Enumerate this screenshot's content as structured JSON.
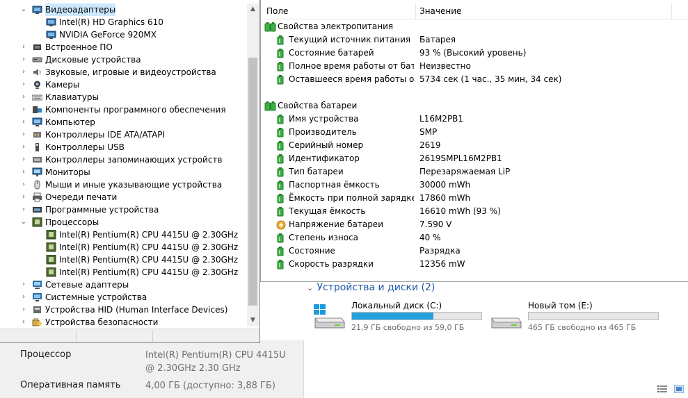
{
  "device_manager": {
    "tree": [
      {
        "label": "Видеоадаптеры",
        "expanded": true,
        "level": 0,
        "icon": "display-adapter-icon",
        "selected": true
      },
      {
        "label": "Intel(R) HD Graphics 610",
        "level": 1,
        "icon": "display-adapter-icon"
      },
      {
        "label": "NVIDIA GeForce 920MX",
        "level": 1,
        "icon": "display-adapter-icon"
      },
      {
        "label": "Встроенное ПО",
        "expanded": false,
        "level": 0,
        "icon": "firmware-icon"
      },
      {
        "label": "Дисковые устройства",
        "expanded": false,
        "level": 0,
        "icon": "disk-drive-icon"
      },
      {
        "label": "Звуковые, игровые и видеоустройства",
        "expanded": false,
        "level": 0,
        "icon": "speaker-icon"
      },
      {
        "label": "Камеры",
        "expanded": false,
        "level": 0,
        "icon": "camera-icon"
      },
      {
        "label": "Клавиатуры",
        "expanded": false,
        "level": 0,
        "icon": "keyboard-icon"
      },
      {
        "label": "Компоненты программного обеспечения",
        "expanded": false,
        "level": 0,
        "icon": "software-component-icon"
      },
      {
        "label": "Компьютер",
        "expanded": false,
        "level": 0,
        "icon": "computer-icon"
      },
      {
        "label": "Контроллеры IDE ATA/ATAPI",
        "expanded": false,
        "level": 0,
        "icon": "ide-controller-icon"
      },
      {
        "label": "Контроллеры USB",
        "expanded": false,
        "level": 0,
        "icon": "usb-controller-icon"
      },
      {
        "label": "Контроллеры запоминающих устройств",
        "expanded": false,
        "level": 0,
        "icon": "storage-controller-icon"
      },
      {
        "label": "Мониторы",
        "expanded": false,
        "level": 0,
        "icon": "monitor-icon"
      },
      {
        "label": "Мыши и иные указывающие устройства",
        "expanded": false,
        "level": 0,
        "icon": "mouse-icon"
      },
      {
        "label": "Очереди печати",
        "expanded": false,
        "level": 0,
        "icon": "printer-icon"
      },
      {
        "label": "Программные устройства",
        "expanded": false,
        "level": 0,
        "icon": "software-device-icon"
      },
      {
        "label": "Процессоры",
        "expanded": true,
        "level": 0,
        "icon": "processor-icon"
      },
      {
        "label": "Intel(R) Pentium(R) CPU 4415U @ 2.30GHz",
        "level": 1,
        "icon": "processor-icon"
      },
      {
        "label": "Intel(R) Pentium(R) CPU 4415U @ 2.30GHz",
        "level": 1,
        "icon": "processor-icon"
      },
      {
        "label": "Intel(R) Pentium(R) CPU 4415U @ 2.30GHz",
        "level": 1,
        "icon": "processor-icon"
      },
      {
        "label": "Intel(R) Pentium(R) CPU 4415U @ 2.30GHz",
        "level": 1,
        "icon": "processor-icon"
      },
      {
        "label": "Сетевые адаптеры",
        "expanded": false,
        "level": 0,
        "icon": "network-adapter-icon"
      },
      {
        "label": "Системные устройства",
        "expanded": false,
        "level": 0,
        "icon": "system-device-icon"
      },
      {
        "label": "Устройства HID (Human Interface Devices)",
        "expanded": false,
        "level": 0,
        "icon": "hid-icon"
      },
      {
        "label": "Устройства безопасности",
        "expanded": false,
        "level": 0,
        "icon": "security-device-icon"
      }
    ]
  },
  "properties": {
    "columns": {
      "field": "Поле",
      "value": "Значение"
    },
    "rows": [
      {
        "kind": "group",
        "name": "Свойства электропитания",
        "value": "",
        "icon": "battery-group-icon"
      },
      {
        "kind": "item",
        "name": "Текущий источник питания",
        "value": "Батарея",
        "icon": "battery-icon"
      },
      {
        "kind": "item",
        "name": "Состояние батарей",
        "value": "93 % (Высокий уровень)",
        "icon": "battery-icon"
      },
      {
        "kind": "item",
        "name": "Полное время работы от бата...",
        "value": "Неизвестно",
        "icon": "battery-icon"
      },
      {
        "kind": "item",
        "name": "Оставшееся время работы от ...",
        "value": "5734 сек (1 час., 35 мин, 34 сек)",
        "icon": "battery-icon"
      },
      {
        "kind": "spacer"
      },
      {
        "kind": "group",
        "name": "Свойства батареи",
        "value": "",
        "icon": "battery-group-icon"
      },
      {
        "kind": "item",
        "name": "Имя устройства",
        "value": "L16M2PB1",
        "icon": "battery-icon"
      },
      {
        "kind": "item",
        "name": "Производитель",
        "value": "SMP",
        "icon": "battery-icon"
      },
      {
        "kind": "item",
        "name": "Серийный номер",
        "value": "2619",
        "icon": "battery-icon"
      },
      {
        "kind": "item",
        "name": "Идентификатор",
        "value": "2619SMPL16M2PB1",
        "icon": "battery-icon"
      },
      {
        "kind": "item",
        "name": "Тип батареи",
        "value": "Перезаряжаемая LiP",
        "icon": "battery-icon"
      },
      {
        "kind": "item",
        "name": "Паспортная ёмкость",
        "value": "30000 mWh",
        "icon": "battery-icon"
      },
      {
        "kind": "item",
        "name": "Ёмкость при полной зарядке",
        "value": "17860 mWh",
        "icon": "battery-icon"
      },
      {
        "kind": "item",
        "name": "Текущая ёмкость",
        "value": "16610 mWh  (93 %)",
        "icon": "battery-icon"
      },
      {
        "kind": "item",
        "name": "Напряжение батареи",
        "value": "7.590 V",
        "icon": "voltage-icon"
      },
      {
        "kind": "item",
        "name": "Степень износа",
        "value": "40 %",
        "icon": "battery-icon"
      },
      {
        "kind": "item",
        "name": "Состояние",
        "value": "Разрядка",
        "icon": "battery-icon"
      },
      {
        "kind": "item",
        "name": "Скорость разрядки",
        "value": "12356 mW",
        "icon": "battery-icon"
      }
    ]
  },
  "drives": {
    "header": "Устройства и диски (2)",
    "items": [
      {
        "name": "Локальный диск (C:)",
        "free_text": "21,9 ГБ свободно из 59,0 ГБ",
        "used_fraction": 0.629,
        "icon": "windows-drive-icon"
      },
      {
        "name": "Новый том (E:)",
        "free_text": "465 ГБ свободно из 465 ГБ",
        "used_fraction": 0.0,
        "icon": "drive-icon"
      }
    ]
  },
  "system_info": {
    "cpu_label": "Процессор",
    "cpu_value": "Intel(R) Pentium(R) CPU 4415U @ 2.30GHz   2.30 GHz",
    "ram_label": "Оперативная память",
    "ram_value": "4,00 ГБ (доступно: 3,88 ГБ)"
  },
  "colors": {
    "accent": "#26a0da",
    "battery_green": "#3cb043",
    "header_blue": "#1e5aa8",
    "selection": "#cce8ff"
  }
}
